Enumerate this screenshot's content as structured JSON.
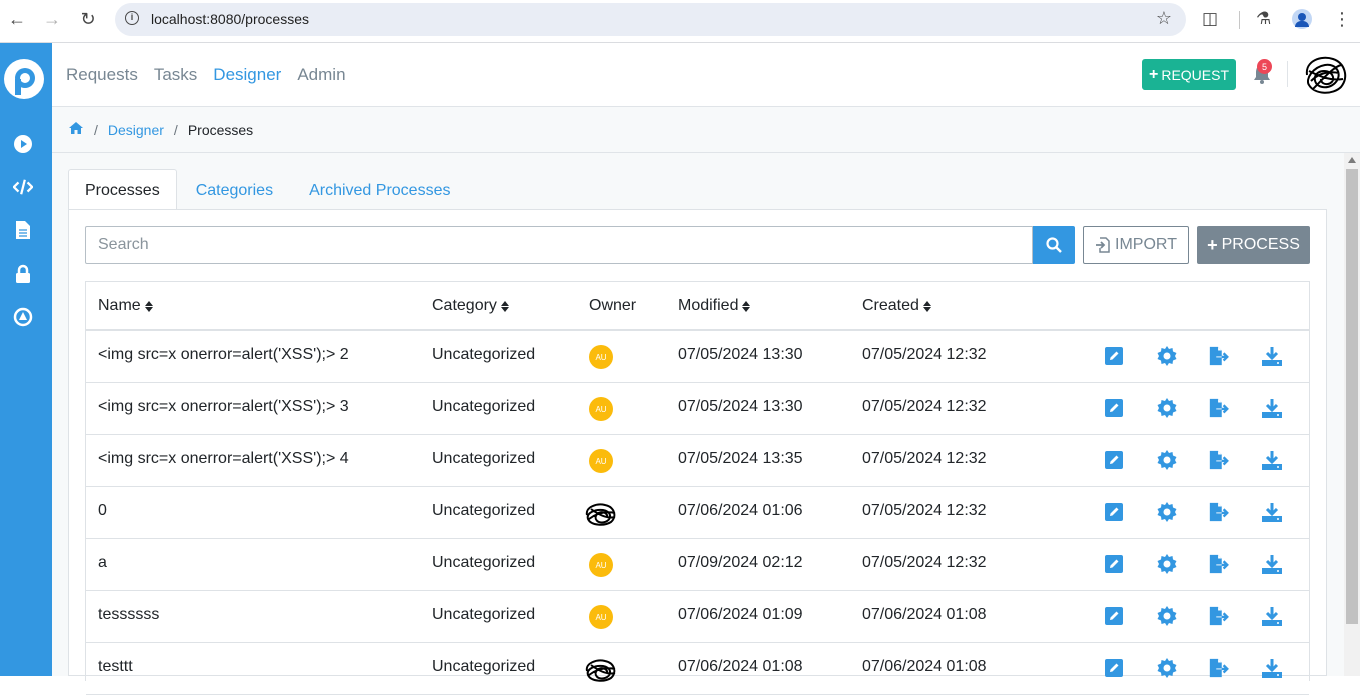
{
  "browser": {
    "url": "localhost:8080/processes"
  },
  "topnav": {
    "links": [
      "Requests",
      "Tasks",
      "Designer",
      "Admin"
    ],
    "active": "Designer",
    "request_button": "REQUEST",
    "notification_count": "5"
  },
  "breadcrumb": {
    "designer": "Designer",
    "current": "Processes"
  },
  "tabs": [
    "Processes",
    "Categories",
    "Archived Processes"
  ],
  "search": {
    "placeholder": "Search"
  },
  "buttons": {
    "import": "IMPORT",
    "process": "PROCESS"
  },
  "table": {
    "headers": {
      "name": "Name",
      "category": "Category",
      "owner": "Owner",
      "modified": "Modified",
      "created": "Created"
    },
    "rows": [
      {
        "name": "<img src=x onerror=alert('XSS');> 2",
        "category": "Uncategorized",
        "owner": "AU",
        "modified": "07/05/2024 13:30",
        "created": "07/05/2024 12:32"
      },
      {
        "name": "<img src=x onerror=alert('XSS');> 3",
        "category": "Uncategorized",
        "owner": "AU",
        "modified": "07/05/2024 13:30",
        "created": "07/05/2024 12:32"
      },
      {
        "name": "<img src=x onerror=alert('XSS');> 4",
        "category": "Uncategorized",
        "owner": "AU",
        "modified": "07/05/2024 13:35",
        "created": "07/05/2024 12:32"
      },
      {
        "name": "0",
        "category": "Uncategorized",
        "owner": "",
        "modified": "07/06/2024 01:06",
        "created": "07/05/2024 12:32"
      },
      {
        "name": "a",
        "category": "Uncategorized",
        "owner": "AU",
        "modified": "07/09/2024 02:12",
        "created": "07/05/2024 12:32"
      },
      {
        "name": "tessssss",
        "category": "Uncategorized",
        "owner": "AU",
        "modified": "07/06/2024 01:09",
        "created": "07/06/2024 01:08"
      },
      {
        "name": "testtt",
        "category": "Uncategorized",
        "owner": "",
        "modified": "07/06/2024 01:08",
        "created": "07/06/2024 01:08"
      }
    ]
  },
  "colors": {
    "primary": "#3397e1",
    "success": "#1ab394",
    "secondary": "#788793",
    "owner_badge": "#fbbb0c",
    "danger": "#ed4757"
  }
}
